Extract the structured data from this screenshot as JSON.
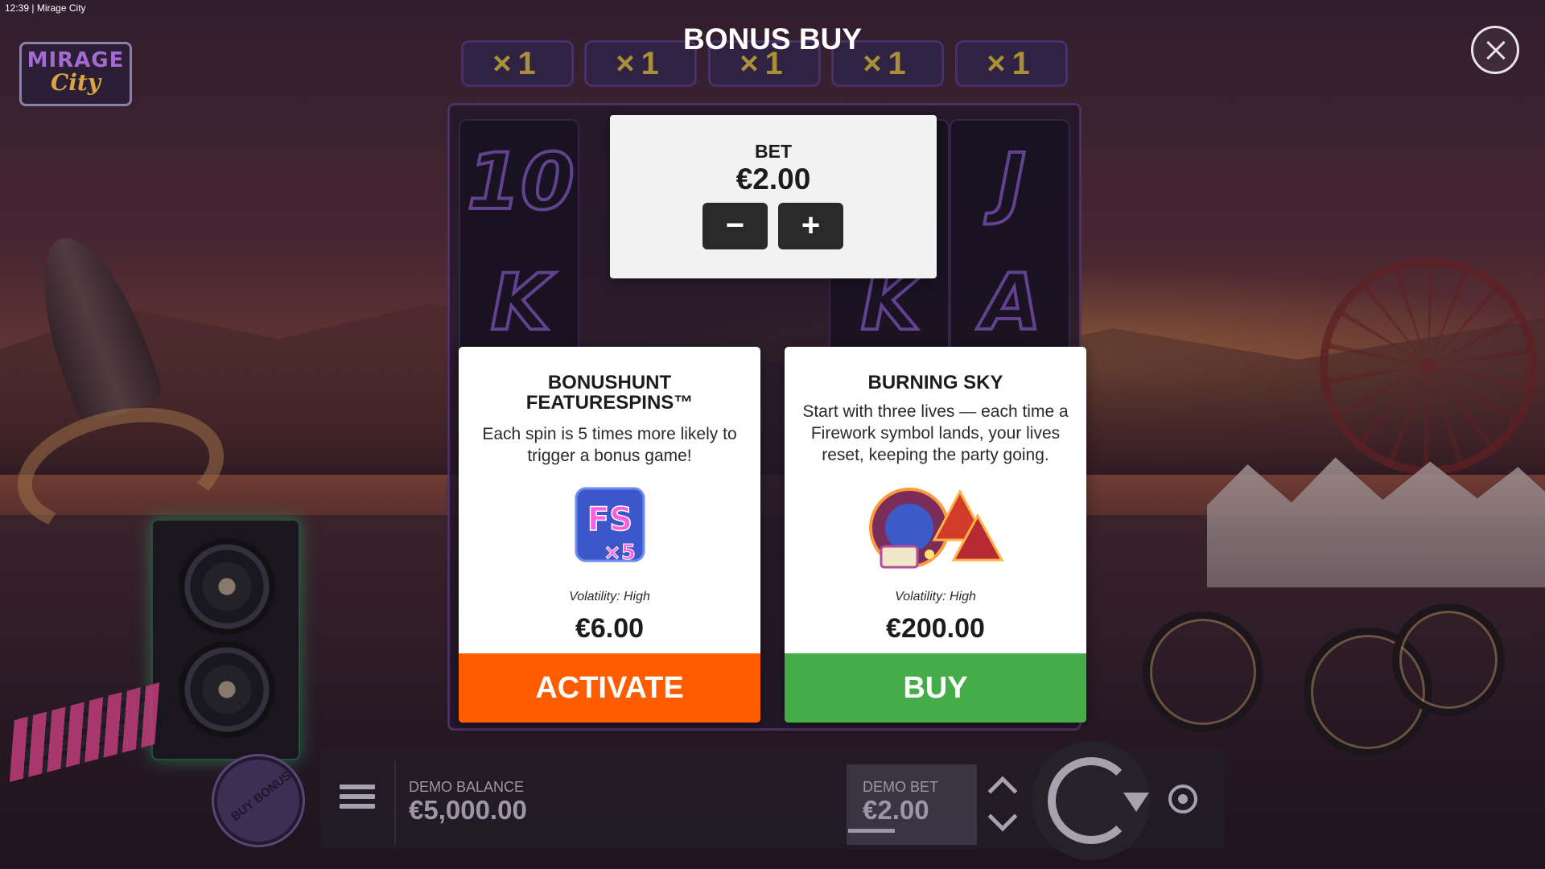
{
  "statusbar": {
    "time": "12:39",
    "separator": "|",
    "app_name": "Mirage City"
  },
  "logo": {
    "line1": "MIRAGE",
    "line2": "City"
  },
  "modal": {
    "title": "BONUS BUY",
    "close_icon": "close-icon",
    "bet": {
      "label": "BET",
      "value": "€2.00",
      "decrease": "−",
      "increase": "+"
    },
    "options": [
      {
        "title": "BONUSHUNT FEATURESPINS™",
        "description": "Each spin is 5 times more likely to trigger a bonus game!",
        "icon": "fs-x5-badge-icon",
        "badge_text": "FS",
        "badge_sub": "×5",
        "volatility": "Volatility: High",
        "price": "€6.00",
        "button": "ACTIVATE",
        "button_color": "#ff5c00"
      },
      {
        "title": "BURNING SKY",
        "description": "Start with three lives — each time a Firework symbol lands, your lives reset, keeping the party going.",
        "icon": "firework-symbols-icon",
        "volatility": "Volatility: High",
        "price": "€200.00",
        "button": "BUY",
        "button_color": "#45ad48"
      }
    ]
  },
  "reels": {
    "multipliers": [
      "×1",
      "×1",
      "×1",
      "×1",
      "×1"
    ],
    "symbols_col1": [
      "10",
      "K"
    ],
    "symbols_col5": [
      "J",
      "A"
    ],
    "symbols_col4": [
      "K"
    ]
  },
  "footer": {
    "buy_bonus": "BUY BONUS",
    "balance_label": "DEMO BALANCE",
    "balance_value": "€5,000.00",
    "bet_label": "DEMO BET",
    "bet_value": "€2.00"
  },
  "colors": {
    "accent_orange": "#ff5c00",
    "accent_green": "#45ad48",
    "panel_bg": "#ffffff"
  }
}
